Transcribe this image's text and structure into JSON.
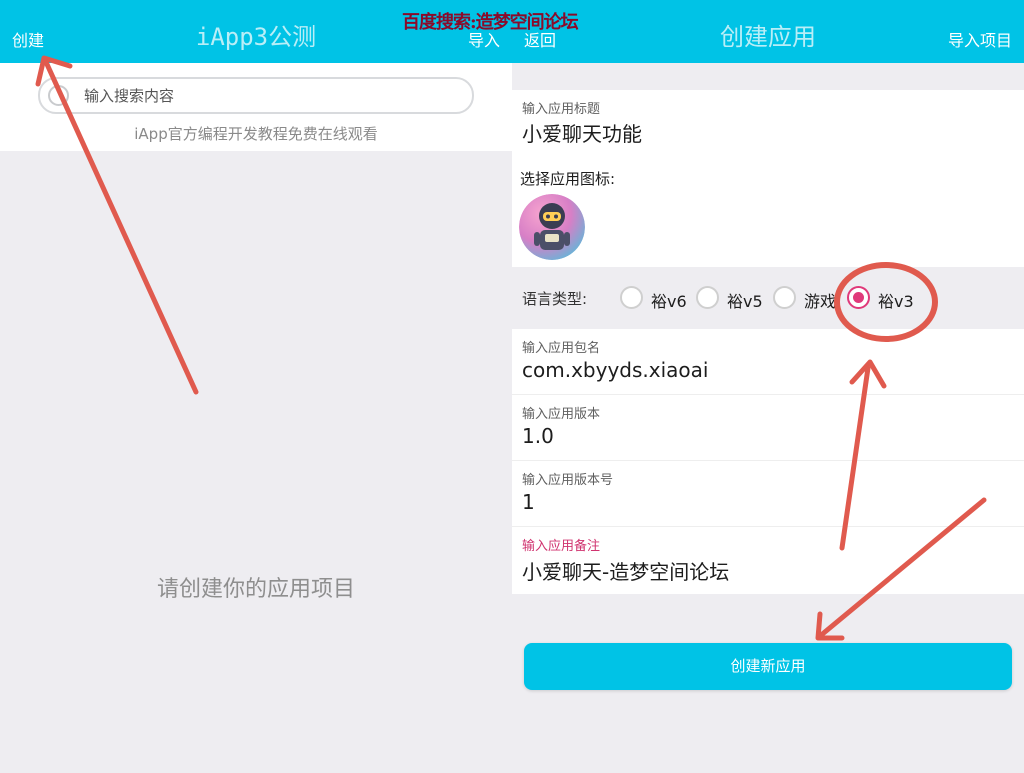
{
  "left": {
    "header": {
      "create_label": "创建",
      "title": "iApp3公测",
      "import_label": "导入"
    },
    "search": {
      "placeholder": "输入搜索内容"
    },
    "tutorial_text": "iApp官方编程开发教程免费在线观看",
    "empty_message": "请创建你的应用项目"
  },
  "right": {
    "header": {
      "back_label": "返回",
      "title": "创建应用",
      "import_project_label": "导入项目"
    },
    "form": {
      "app_title": {
        "label": "输入应用标题",
        "value": "小爱聊天功能"
      },
      "icon_label": "选择应用图标:",
      "language": {
        "label": "语言类型:",
        "options": [
          "裕v6",
          "裕v5",
          "游戏",
          "裕v3"
        ],
        "selected": "裕v3"
      },
      "package_name": {
        "label": "输入应用包名",
        "value": "com.xbyyds.xiaoai"
      },
      "version": {
        "label": "输入应用版本",
        "value": "1.0"
      },
      "version_code": {
        "label": "输入应用版本号",
        "value": "1"
      },
      "note": {
        "label": "输入应用备注",
        "value": "小爱聊天-造梦空间论坛"
      }
    },
    "create_button_label": "创建新应用"
  },
  "watermark_text": "百度搜索:造梦空间论坛",
  "colors": {
    "accent": "#00c3e6",
    "radio_selected": "#e0397a",
    "annotation_red": "#e05a4e",
    "watermark": "#8a0b2a"
  }
}
